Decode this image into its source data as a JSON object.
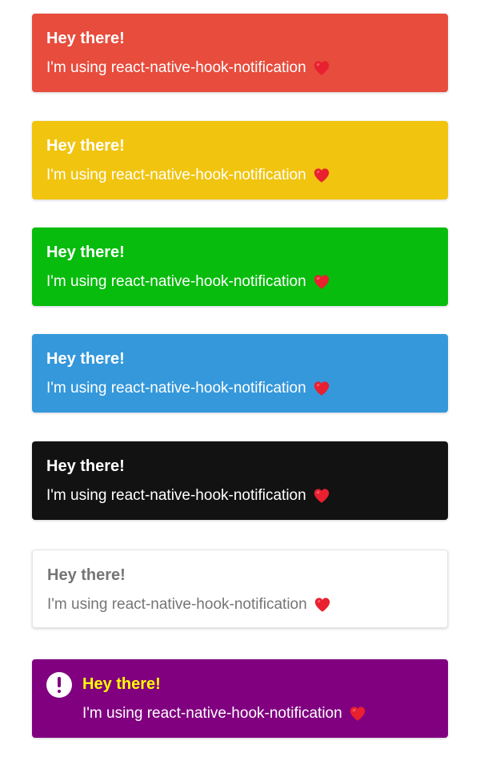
{
  "colors": {
    "heart": "#e8202f",
    "heart_highlight": "#ff5a63"
  },
  "icons": {
    "message_icon": "red-heart",
    "alert_icon": "exclamation-circle"
  },
  "notifications": [
    {
      "title": "Hey there!",
      "message": "I'm using react-native-hook-notification",
      "background": "#e74c3c",
      "title_color": "#ffffff",
      "text_color": "#ffffff"
    },
    {
      "title": "Hey there!",
      "message": "I'm using react-native-hook-notification",
      "background": "#f1c40f",
      "title_color": "#ffffff",
      "text_color": "#ffffff"
    },
    {
      "title": "Hey there!",
      "message": "I'm using react-native-hook-notification",
      "background": "#07bc0c",
      "title_color": "#ffffff",
      "text_color": "#ffffff"
    },
    {
      "title": "Hey there!",
      "message": "I'm using react-native-hook-notification",
      "background": "#3498db",
      "title_color": "#ffffff",
      "text_color": "#ffffff"
    },
    {
      "title": "Hey there!",
      "message": "I'm using react-native-hook-notification",
      "background": "#121212",
      "title_color": "#ffffff",
      "text_color": "#ffffff"
    },
    {
      "title": "Hey there!",
      "message": "I'm using react-native-hook-notification",
      "background": "#ffffff",
      "title_color": "#757575",
      "text_color": "#757575"
    },
    {
      "title": "Hey there!",
      "message": "I'm using react-native-hook-notification",
      "background": "#800080",
      "title_color": "#ffff00",
      "text_color": "#ffffff",
      "icon_color": "#800080"
    }
  ]
}
